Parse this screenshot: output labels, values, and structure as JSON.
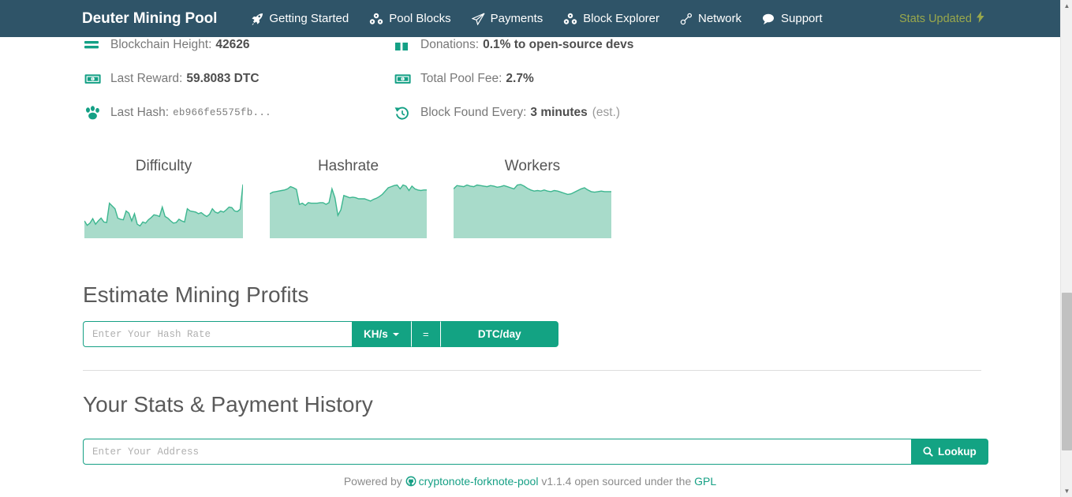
{
  "navbar": {
    "brand": "Deuter Mining Pool",
    "items": [
      {
        "label": "Getting Started",
        "icon": "rocket-icon"
      },
      {
        "label": "Pool Blocks",
        "icon": "cubes-icon"
      },
      {
        "label": "Payments",
        "icon": "paper-plane-icon"
      },
      {
        "label": "Block Explorer",
        "icon": "cubes-icon"
      },
      {
        "label": "Network",
        "icon": "link-icon"
      },
      {
        "label": "Support",
        "icon": "comment-icon"
      }
    ],
    "stats_updated": "Stats Updated",
    "stats_updated_color": "#9aa84b"
  },
  "stats": {
    "left": [
      {
        "icon": "bars-icon",
        "label": "Blockchain Height:",
        "value": "42626",
        "suffix": ""
      },
      {
        "icon": "money-bill-icon",
        "label": "Last Reward:",
        "value": "59.8083 DTC",
        "suffix": ""
      },
      {
        "icon": "paw-icon",
        "label": "Last Hash:",
        "value": "eb966fe5575fb...",
        "suffix": "",
        "mono": true
      }
    ],
    "right": [
      {
        "icon": "gift-icon",
        "label": "Donations:",
        "value": "0.1% to open-source devs",
        "suffix": ""
      },
      {
        "icon": "money-bill-icon",
        "label": "Total Pool Fee:",
        "value": "2.7%",
        "suffix": ""
      },
      {
        "icon": "history-icon",
        "label": "Block Found Every:",
        "value": "3 minutes",
        "suffix": "(est.)"
      }
    ]
  },
  "chart_data": [
    {
      "type": "area",
      "title": "Difficulty",
      "xlabel": "",
      "ylabel": "",
      "grid": false,
      "legend": "none",
      "fill_color": "#a8dbca",
      "line_color": "#3cb68f",
      "ylim": [
        0,
        100
      ],
      "values": [
        30,
        22,
        26,
        34,
        24,
        30,
        35,
        28,
        27,
        62,
        57,
        52,
        35,
        33,
        32,
        48,
        44,
        30,
        43,
        24,
        21,
        28,
        26,
        32,
        36,
        41,
        40,
        38,
        55,
        38,
        35,
        30,
        26,
        27,
        33,
        30,
        28,
        52,
        48,
        47,
        46,
        43,
        45,
        41,
        38,
        42,
        52,
        46,
        44,
        48,
        46,
        50,
        55,
        54,
        48,
        47,
        51,
        96
      ]
    },
    {
      "type": "area",
      "title": "Hashrate",
      "xlabel": "",
      "ylabel": "",
      "grid": false,
      "legend": "none",
      "fill_color": "#a8dbca",
      "line_color": "#3cb68f",
      "ylim": [
        0,
        100
      ],
      "values": [
        79,
        82,
        83,
        84,
        85,
        86,
        88,
        92,
        90,
        87,
        60,
        62,
        58,
        63,
        62,
        62,
        62,
        63,
        63,
        60,
        63,
        88,
        72,
        40,
        50,
        76,
        74,
        72,
        73,
        72,
        70,
        70,
        70,
        68,
        66,
        69,
        71,
        74,
        78,
        84,
        90,
        92,
        94,
        95,
        88,
        95,
        93,
        85,
        93,
        88,
        86,
        85,
        86,
        86
      ]
    },
    {
      "type": "area",
      "title": "Workers",
      "xlabel": "",
      "ylabel": "",
      "grid": false,
      "legend": "none",
      "fill_color": "#a8dbca",
      "line_color": "#3cb68f",
      "ylim": [
        0,
        100
      ],
      "values": [
        88,
        94,
        93,
        92,
        95,
        93,
        92,
        95,
        94,
        93,
        92,
        94,
        93,
        91,
        92,
        94,
        92,
        90,
        88,
        95,
        96,
        93,
        89,
        86,
        84,
        85,
        84,
        86,
        84,
        83,
        85,
        84,
        82,
        80,
        78,
        79,
        82,
        85,
        88,
        90,
        86,
        83,
        82,
        83,
        84,
        83,
        83,
        83
      ]
    }
  ],
  "estimate": {
    "heading": "Estimate Mining Profits",
    "hash_rate_placeholder": "Enter Your Hash Rate",
    "hash_rate_value": "",
    "unit_label": "KH/s",
    "equals_label": "=",
    "result_label": "DTC/day"
  },
  "your_stats": {
    "heading": "Your Stats & Payment History",
    "address_placeholder": "Enter Your Address",
    "address_value": "",
    "lookup_label": "Lookup"
  },
  "footer": {
    "powered_by": "Powered by",
    "project": "cryptonote-forknote-pool",
    "version": "v1.1.4 open sourced under the",
    "license": "GPL"
  },
  "theme": {
    "navbar_bg": "#2f5468",
    "accent_green": "#13a383",
    "link_green": "#16a085",
    "chart_fill": "#a8dbca",
    "chart_line": "#3cb68f"
  }
}
